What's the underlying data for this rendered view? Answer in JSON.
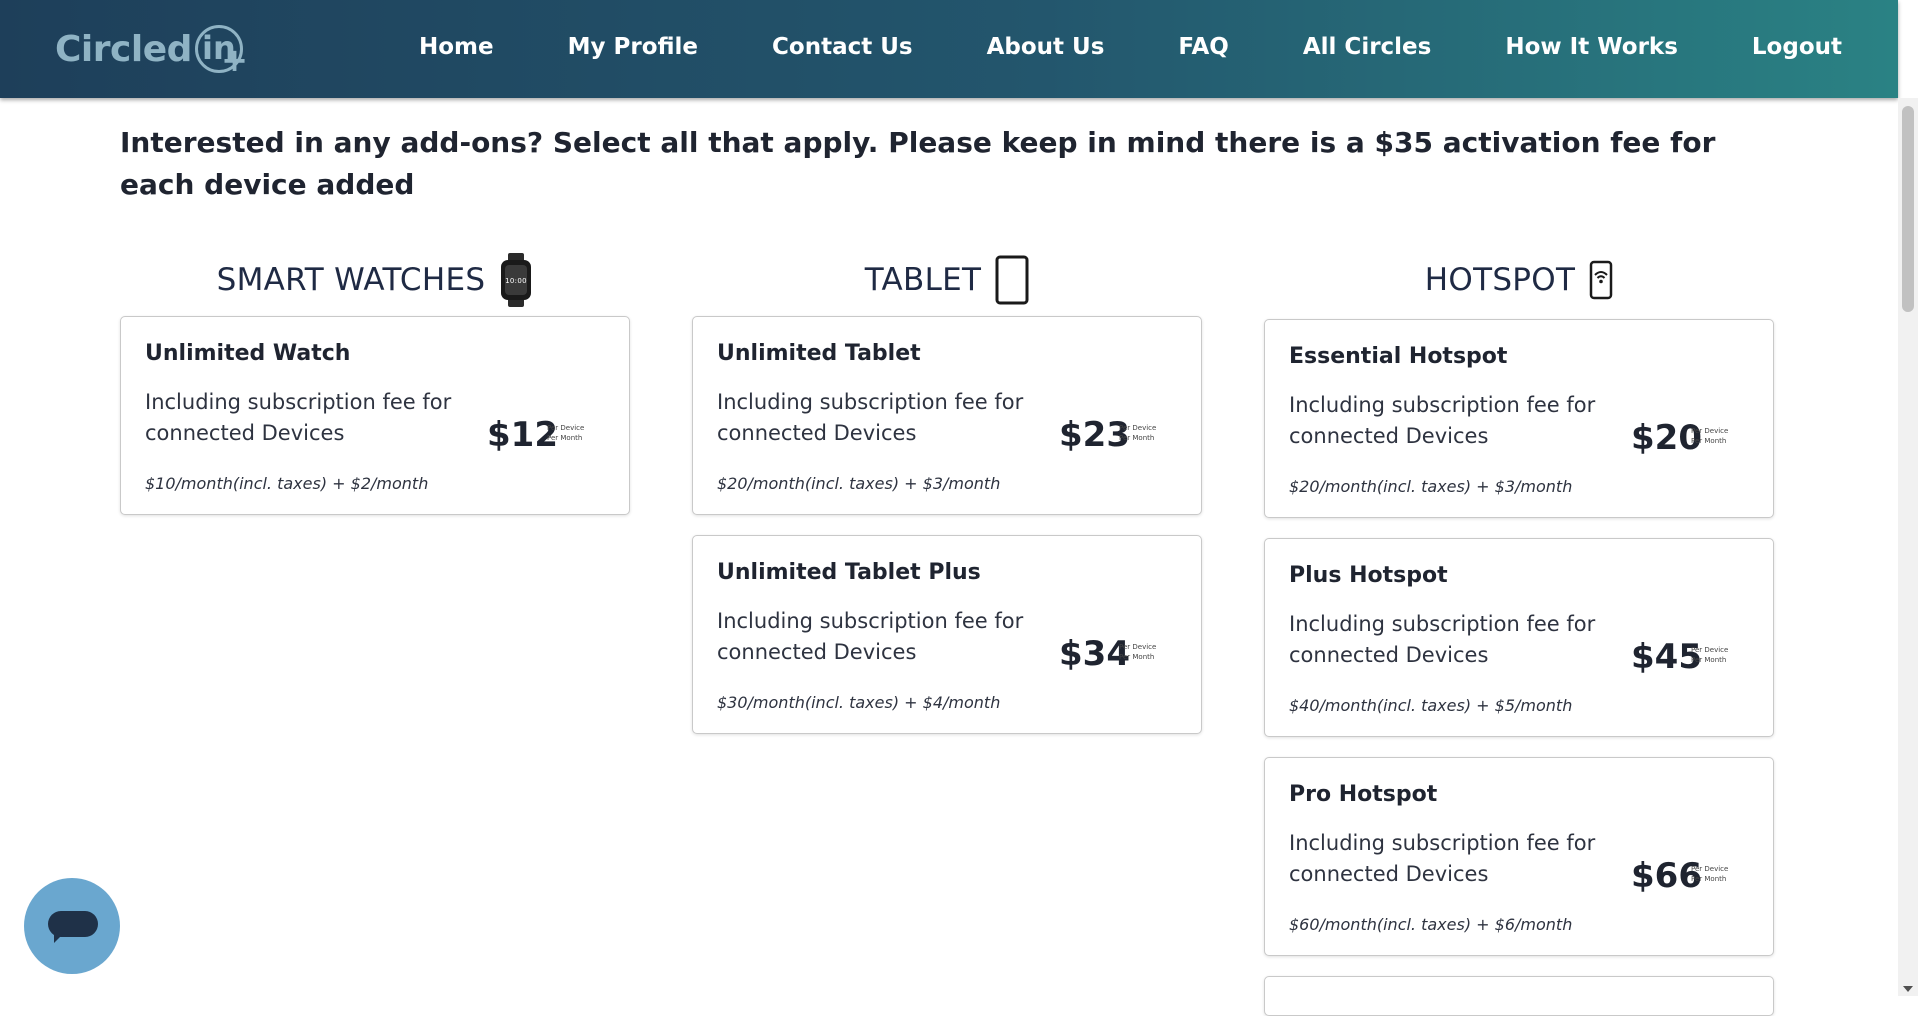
{
  "brand": {
    "name": "Circled",
    "circle_letters": "in",
    "plus": "+"
  },
  "nav": [
    "Home",
    "My Profile",
    "Contact Us",
    "About Us",
    "FAQ",
    "All Circles",
    "How It Works",
    "Logout"
  ],
  "intro": "Interested in any add-ons? Select all that apply. Please keep in mind there is a $35 activation fee for each device added",
  "columns": [
    {
      "heading": "SMART WATCHES",
      "icon": "smartwatch-icon",
      "watch_time": "10:00",
      "plans": [
        {
          "title": "Unlimited Watch",
          "desc": "Including subscription fee for connected Devices",
          "price": "$12",
          "per_device": "Per Device",
          "per_month": "Per Month",
          "fine": "$10/month(incl. taxes) + $2/month"
        }
      ]
    },
    {
      "heading": "TABLET",
      "icon": "tablet-icon",
      "plans": [
        {
          "title": "Unlimited Tablet",
          "desc": "Including subscription fee for connected Devices",
          "price": "$23",
          "per_device": "Per Device",
          "per_month": "Per Month",
          "fine": "$20/month(incl. taxes) + $3/month"
        },
        {
          "title": "Unlimited Tablet Plus",
          "desc": "Including subscription fee for connected Devices",
          "price": "$34",
          "per_device": "Per Device",
          "per_month": "Per Month",
          "fine": "$30/month(incl. taxes) + $4/month"
        }
      ]
    },
    {
      "heading": "HOTSPOT",
      "icon": "hotspot-icon",
      "plans": [
        {
          "title": "Essential Hotspot",
          "desc": "Including subscription fee for connected Devices",
          "price": "$20",
          "per_device": "Per Device",
          "per_month": "Per Month",
          "fine": "$20/month(incl. taxes) + $3/month"
        },
        {
          "title": "Plus Hotspot",
          "desc": "Including subscription fee for connected Devices",
          "price": "$45",
          "per_device": "Per Device",
          "per_month": "Per Month",
          "fine": "$40/month(incl. taxes) + $5/month"
        },
        {
          "title": "Pro Hotspot",
          "desc": "Including subscription fee for connected Devices",
          "price": "$66",
          "per_device": "Per Device",
          "per_month": "Per Month",
          "fine": "$60/month(incl. taxes) + $6/month"
        }
      ]
    }
  ],
  "chat": {
    "icon": "chat-icon"
  },
  "colors": {
    "header_start": "#1e3f5a",
    "header_end": "#2a8284",
    "chat": "#6aa7cf"
  }
}
